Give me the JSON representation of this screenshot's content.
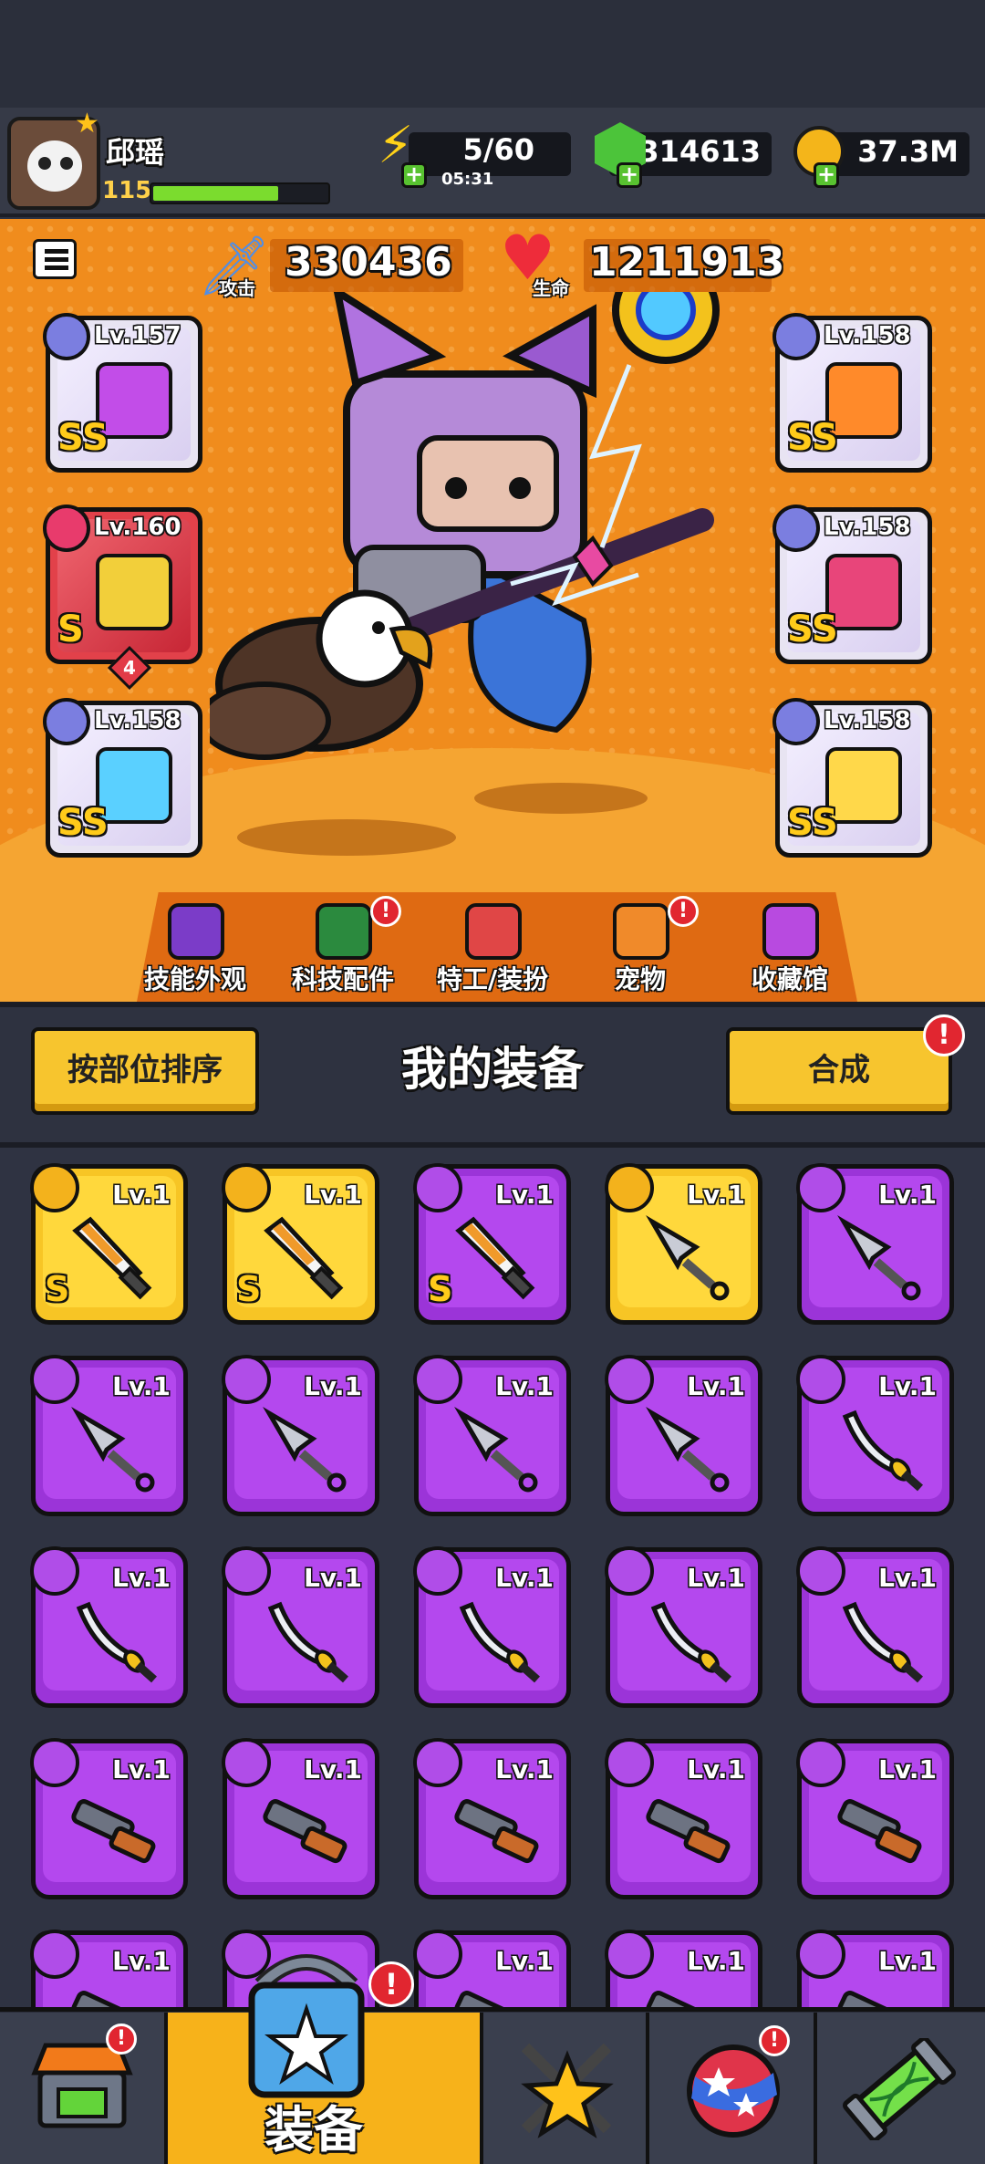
{
  "header": {
    "player_name": "邱瑶",
    "player_level": "115",
    "xp_fraction": 0.72,
    "energy": "5/60",
    "energy_timer": "05:31",
    "gems": "314613",
    "gold": "37.3M"
  },
  "stats": {
    "attack_value": "330436",
    "attack_label": "攻击",
    "hp_value": "1211913",
    "hp_label": "生命"
  },
  "equipped": [
    {
      "level": "Lv.157",
      "tier": "SS",
      "style": "white"
    },
    {
      "level": "Lv.160",
      "tier": "S",
      "stars": "4",
      "style": "red"
    },
    {
      "level": "Lv.158",
      "tier": "SS",
      "style": "white"
    },
    {
      "level": "Lv.158",
      "tier": "SS",
      "style": "white"
    },
    {
      "level": "Lv.158",
      "tier": "SS",
      "style": "white"
    },
    {
      "level": "Lv.158",
      "tier": "SS",
      "style": "white"
    }
  ],
  "features": [
    {
      "label": "技能外观",
      "badge": false
    },
    {
      "label": "科技配件",
      "badge": true
    },
    {
      "label": "特工/装扮",
      "badge": false
    },
    {
      "label": "宠物",
      "badge": true
    },
    {
      "label": "收藏馆",
      "badge": false
    }
  ],
  "section": {
    "sort_button": "按部位排序",
    "title": "我的装备",
    "merge_button": "合成",
    "merge_badge": "!"
  },
  "inventory": [
    {
      "level": "Lv.1",
      "color": "yellow",
      "tier": "S",
      "item": "sword"
    },
    {
      "level": "Lv.1",
      "color": "yellow",
      "tier": "S",
      "item": "sword"
    },
    {
      "level": "Lv.1",
      "color": "purple",
      "tier": "S",
      "item": "sword"
    },
    {
      "level": "Lv.1",
      "color": "yellow",
      "tier": "",
      "item": "kunai"
    },
    {
      "level": "Lv.1",
      "color": "purple",
      "tier": "",
      "item": "kunai"
    },
    {
      "level": "Lv.1",
      "color": "purple",
      "tier": "",
      "item": "kunai"
    },
    {
      "level": "Lv.1",
      "color": "purple",
      "tier": "",
      "item": "kunai"
    },
    {
      "level": "Lv.1",
      "color": "purple",
      "tier": "",
      "item": "kunai"
    },
    {
      "level": "Lv.1",
      "color": "purple",
      "tier": "",
      "item": "kunai"
    },
    {
      "level": "Lv.1",
      "color": "purple",
      "tier": "",
      "item": "katana"
    },
    {
      "level": "Lv.1",
      "color": "purple",
      "tier": "",
      "item": "katana"
    },
    {
      "level": "Lv.1",
      "color": "purple",
      "tier": "",
      "item": "katana"
    },
    {
      "level": "Lv.1",
      "color": "purple",
      "tier": "",
      "item": "katana"
    },
    {
      "level": "Lv.1",
      "color": "purple",
      "tier": "",
      "item": "katana"
    },
    {
      "level": "Lv.1",
      "color": "purple",
      "tier": "",
      "item": "katana"
    },
    {
      "level": "Lv.1",
      "color": "purple",
      "tier": "",
      "item": "shotgun"
    },
    {
      "level": "Lv.1",
      "color": "purple",
      "tier": "",
      "item": "shotgun"
    },
    {
      "level": "Lv.1",
      "color": "purple",
      "tier": "",
      "item": "shotgun"
    },
    {
      "level": "Lv.1",
      "color": "purple",
      "tier": "",
      "item": "shotgun"
    },
    {
      "level": "Lv.1",
      "color": "purple",
      "tier": "",
      "item": "shotgun"
    },
    {
      "level": "Lv.1",
      "color": "purple",
      "tier": "",
      "item": "shotgun"
    },
    {
      "level": "",
      "color": "purple",
      "tier": "",
      "item": "shotgun"
    },
    {
      "level": "Lv.1",
      "color": "purple",
      "tier": "",
      "item": "shotgun"
    },
    {
      "level": "Lv.1",
      "color": "purple",
      "tier": "",
      "item": "shotgun"
    },
    {
      "level": "Lv.1",
      "color": "purple",
      "tier": "",
      "item": "shotgun"
    }
  ],
  "nav": {
    "shop_icon": "shop-icon",
    "equip_label": "装备",
    "heroes_icon": "crossed-swords-star-icon",
    "planet_icon": "planet-icon",
    "evolve_icon": "dna-capsule-icon",
    "badge": "!"
  },
  "colors": {
    "stage_orange": "#f08c1d",
    "purple_rarity": "#9b34d8",
    "yellow_rarity": "#f7c525",
    "alert_red": "#e12630"
  }
}
